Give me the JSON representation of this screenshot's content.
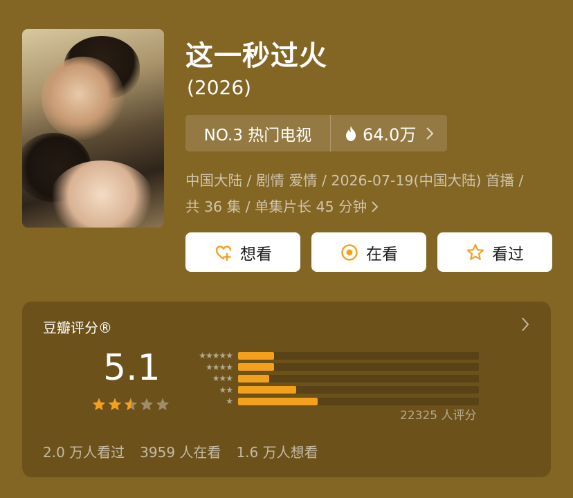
{
  "title": "这一秒过火",
  "year": "(2026)",
  "rank": {
    "label": "NO.3 热门电视",
    "heat": "64.0万"
  },
  "meta": {
    "line1": "中国大陆 / 剧情 爱情 / 2026-07-19(中国大陆) 首播 /",
    "line2": "共 36 集 / 单集片长 45 分钟"
  },
  "buttons": {
    "want": "想看",
    "watching": "在看",
    "watched": "看过"
  },
  "rating": {
    "label": "豆瓣评分®",
    "score": "5.1",
    "stars_value": 2.5,
    "stars_max": 5,
    "distribution": [
      {
        "stars": "★★★★★",
        "fraction": 0.15
      },
      {
        "stars": "★★★★",
        "fraction": 0.15
      },
      {
        "stars": "★★★",
        "fraction": 0.13
      },
      {
        "stars": "★★",
        "fraction": 0.24
      },
      {
        "stars": "★",
        "fraction": 0.33
      }
    ],
    "count": "22325 人评分"
  },
  "stats": {
    "watched": "2.0 万人看过",
    "watching": "3959 人在看",
    "want": "1.6 万人想看"
  },
  "colors": {
    "background": "#836524",
    "bar": "#f3a01d",
    "star": "#f3a01d",
    "accent_heart": "#f3a01d"
  }
}
